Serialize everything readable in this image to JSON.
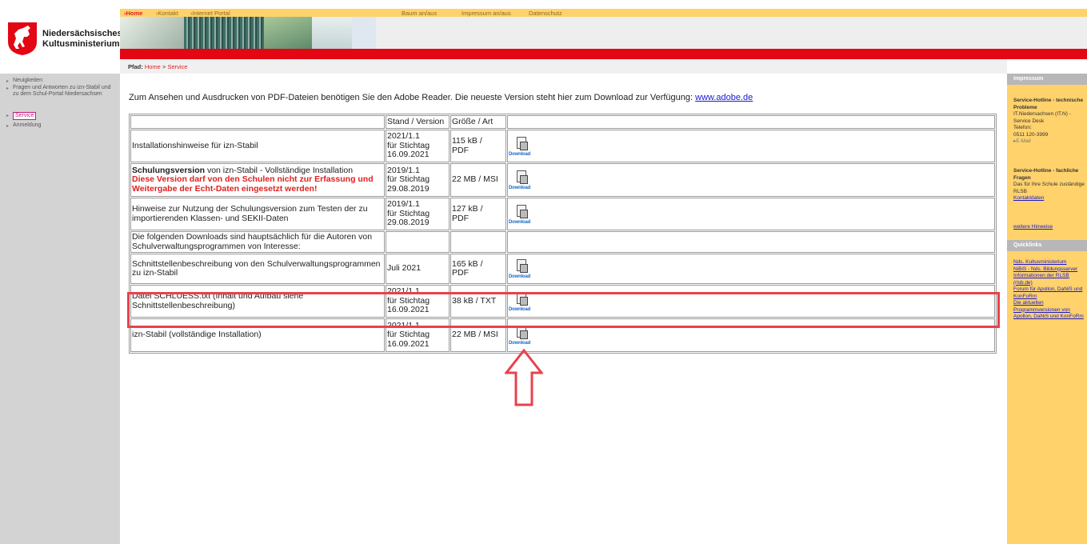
{
  "header": {
    "logo_line1": "Niedersächsisches",
    "logo_line2": "Kultusministerium",
    "topnav": [
      "›Home",
      "›Kontakt",
      "›Internet Portal"
    ],
    "topnav_right": [
      "Baum an/aus",
      "Impressum an/aus",
      "Datenschutz"
    ]
  },
  "breadcrumb": {
    "label": "Pfad:",
    "home": "Home",
    "sep": ">",
    "current": "Service"
  },
  "sidebar": {
    "items": [
      {
        "label": "Neuigkeiten"
      },
      {
        "label": "Fragen und Antworten zu izn-Stabil und zu dem Schul-Portal Niedersachsen"
      },
      {
        "label": "Service"
      },
      {
        "label": "Anmeldung"
      }
    ]
  },
  "rightbar": {
    "impressum_title": "Impressum",
    "hotline1_title": "Service-Hotline - technische Probleme",
    "hotline1_org": "IT.Niedersachsen (IT.N) - Service Desk",
    "hotline1_tel_label": "Telefon:",
    "hotline1_tel": "0511 120-3999",
    "hotline1_mail": "E-Mail",
    "hotline2_title": "Service-Hotline - fachliche Fragen",
    "hotline2_text": "Das für Ihre Schule zuständige RLSB",
    "hotline2_link": "Kontaktdaten",
    "more_link": "weitere Hinweise",
    "quicklinks_title": "Quicklinks",
    "quicklinks": [
      "Nds. Kultusministerium",
      "NiBiS - Nds. Bildungsserver",
      "Informationen der RLSB (rlsb.de)",
      "Forum für Apollon, DaNiS und KonFoRm",
      "Die aktuellen Programmversionen von Apollon, DaNiS und KonFoRm"
    ]
  },
  "intro": {
    "text": "Zum Ansehen und Ausdrucken von PDF-Dateien benötigen Sie den Adobe Reader. Die neueste Version steht hier zum Download zur Verfügung: ",
    "link": "www.adobe.de"
  },
  "table": {
    "headers": [
      "",
      "Stand / Version",
      "Größe / Art",
      ""
    ],
    "download_label": "Download",
    "rows": [
      {
        "desc": "Installationshinweise für izn-Stabil",
        "stand": [
          "2021/1.1",
          "für Stichtag",
          "16.09.2021"
        ],
        "size": [
          "115 kB /",
          "PDF"
        ]
      },
      {
        "desc_bold": "Schulungsversion",
        "desc": " von izn-Stabil - Vollständige Installation",
        "desc_warn": "Diese Version darf von den Schulen nicht zur Erfassung und Weitergabe der Echt-Daten eingesetzt werden!",
        "stand": [
          "2019/1.1",
          "für Stichtag",
          "29.08.2019"
        ],
        "size": [
          "22 MB / MSI"
        ]
      },
      {
        "desc": "Hinweise zur Nutzung der Schulungsversion zum Testen der zu importierenden Klassen- und SEKII-Daten",
        "stand": [
          "2019/1.1",
          "für Stichtag",
          "29.08.2019"
        ],
        "size": [
          "127 kB /",
          "PDF"
        ]
      },
      {
        "desc": "Die folgenden Downloads sind hauptsächlich für die Autoren von Schulverwaltungsprogrammen von Interesse:"
      },
      {
        "desc": "Schnittstellenbeschreibung von den Schulverwaltungsprogrammen zu izn-Stabil",
        "stand": [
          "Juli 2021"
        ],
        "size": [
          "165 kB /",
          "PDF"
        ]
      },
      {
        "desc": "Datei SCHLUESS.txt (Inhalt und Aufbau siehe Schnittstellenbeschreibung)",
        "stand": [
          "2021/1.1",
          "für Stichtag",
          "16.09.2021"
        ],
        "size": [
          "38 kB / TXT"
        ]
      },
      {
        "desc": "izn-Stabil (vollständige Installation)",
        "stand": [
          "2021/1.1",
          "für Stichtag",
          "16.09.2021"
        ],
        "size": [
          "22 MB / MSI"
        ]
      }
    ]
  },
  "colors": {
    "header_yellow": "#ffd26b",
    "red_bar": "#e30613",
    "highlight": "#e8424c"
  }
}
